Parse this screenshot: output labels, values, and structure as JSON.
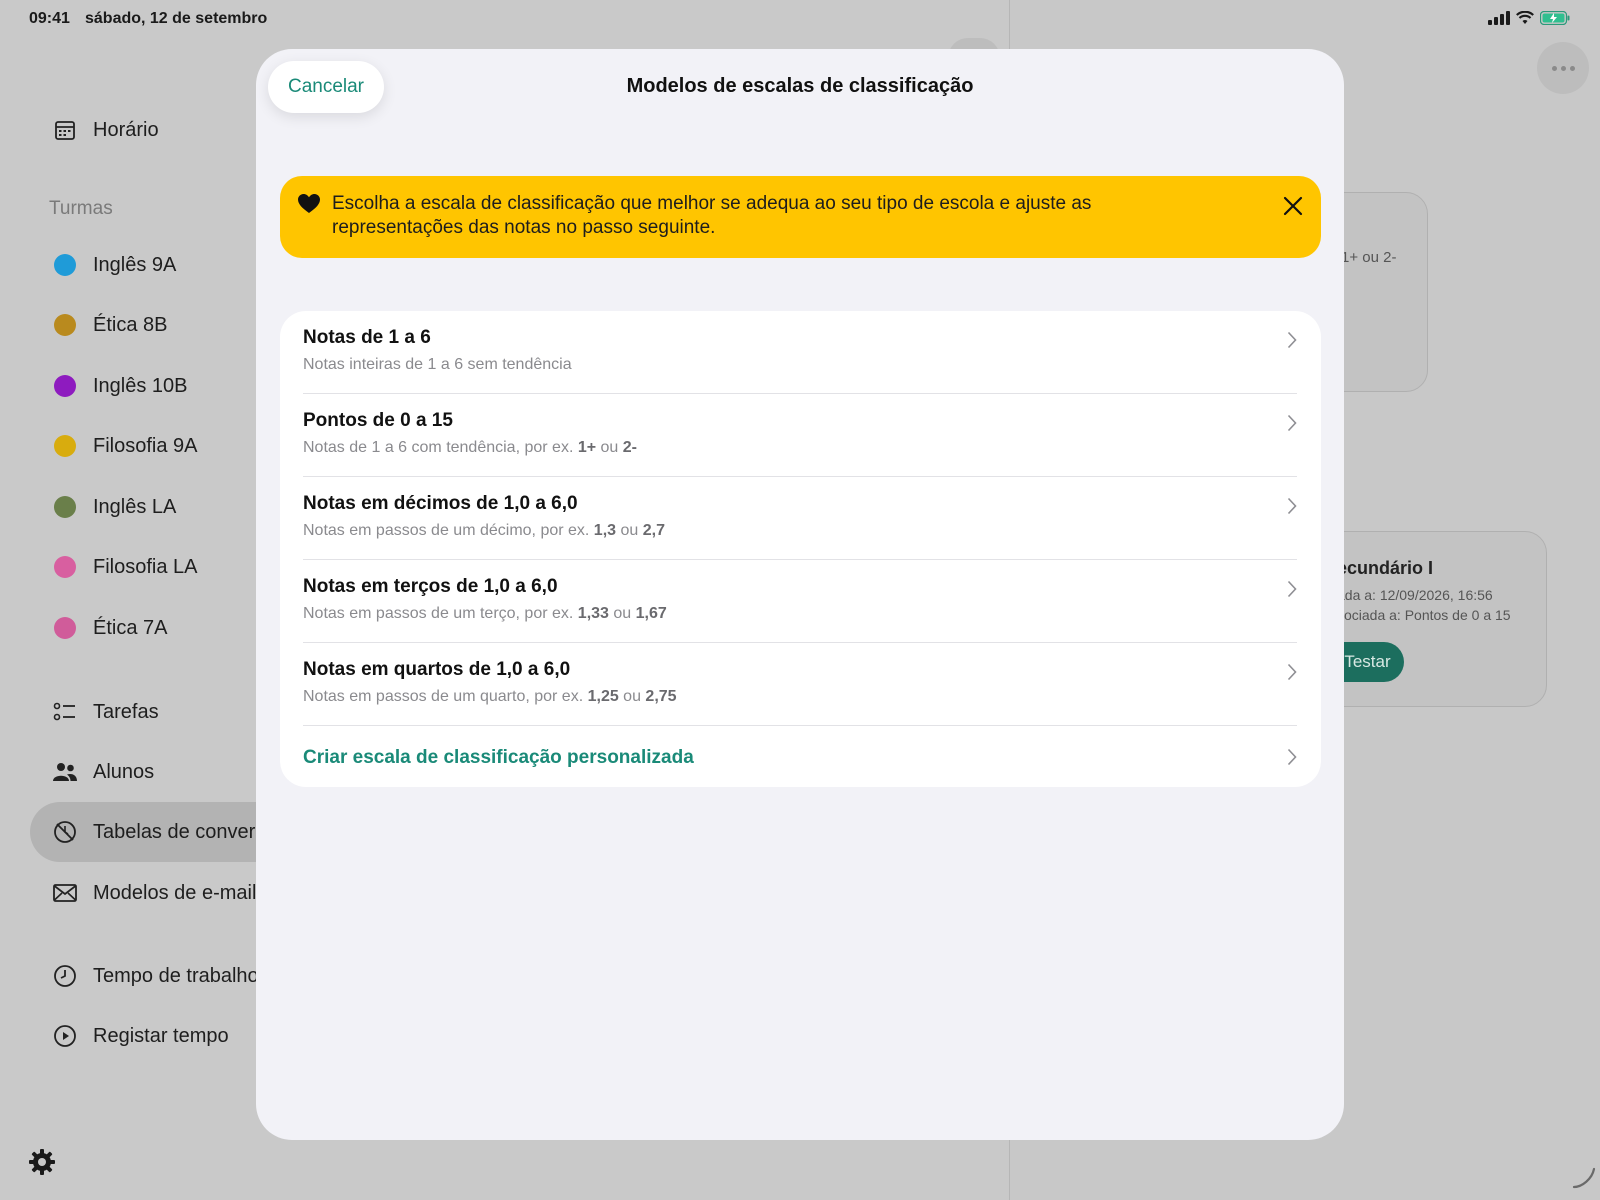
{
  "status": {
    "time": "09:41",
    "date": "sábado, 12 de setembro"
  },
  "sidebar": {
    "schedule_label": "Horário",
    "classes_heading": "Turmas",
    "classes": [
      {
        "label": "Inglês 9A",
        "color": "#1f9bd8"
      },
      {
        "label": "Ética 8B",
        "color": "#b98a1e"
      },
      {
        "label": "Inglês 10B",
        "color": "#8e1bbf"
      },
      {
        "label": "Filosofia 9A",
        "color": "#d8ac0e"
      },
      {
        "label": "Inglês LA",
        "color": "#6a7f4a"
      },
      {
        "label": "Filosofia LA",
        "color": "#d85fa0"
      },
      {
        "label": "Ética 7A",
        "color": "#d05c9a"
      }
    ],
    "tasks_label": "Tarefas",
    "students_label": "Alunos",
    "conversion_label": "Tabelas de convers",
    "email_label": "Modelos de e-mail",
    "worktime_label": "Tempo de trabalho",
    "logtime_label": "Registar tempo"
  },
  "background": {
    "card1_text": "1+ ou 2-",
    "card2_title": "ecundário I",
    "card2_line1": "ada a: 12/09/2026, 16:56",
    "card2_line2": "sociada a: Pontos de 0 a 15",
    "card2_button": "Testar"
  },
  "modal": {
    "cancel_label": "Cancelar",
    "title": "Modelos de escalas de classificação",
    "banner_text": "Escolha a escala de classificação que melhor se adequa ao seu tipo de escola e ajuste as representações das notas no passo seguinte.",
    "accent_color": "#1a8a78",
    "banner_color": "#ffc500",
    "options": [
      {
        "title": "Notas de 1 a 6",
        "sub_prefix": "Notas inteiras de 1 a 6 sem tendência",
        "ex1": "",
        "joiner": "",
        "ex2": ""
      },
      {
        "title": "Pontos de 0 a 15",
        "sub_prefix": "Notas de 1 a 6 com tendência, por ex. ",
        "ex1": "1+",
        "joiner": " ou ",
        "ex2": "2-"
      },
      {
        "title": "Notas em décimos de 1,0 a 6,0",
        "sub_prefix": "Notas em passos de um décimo, por ex. ",
        "ex1": "1,3",
        "joiner": " ou ",
        "ex2": "2,7"
      },
      {
        "title": "Notas em terços de 1,0 a 6,0",
        "sub_prefix": "Notas em passos de um terço, por ex. ",
        "ex1": "1,33",
        "joiner": " ou ",
        "ex2": "1,67"
      },
      {
        "title": "Notas em quartos de 1,0 a 6,0",
        "sub_prefix": "Notas em passos de um quarto, por ex. ",
        "ex1": "1,25",
        "joiner": " ou ",
        "ex2": "2,75"
      }
    ],
    "custom_label": "Criar escala de classificação personalizada"
  }
}
